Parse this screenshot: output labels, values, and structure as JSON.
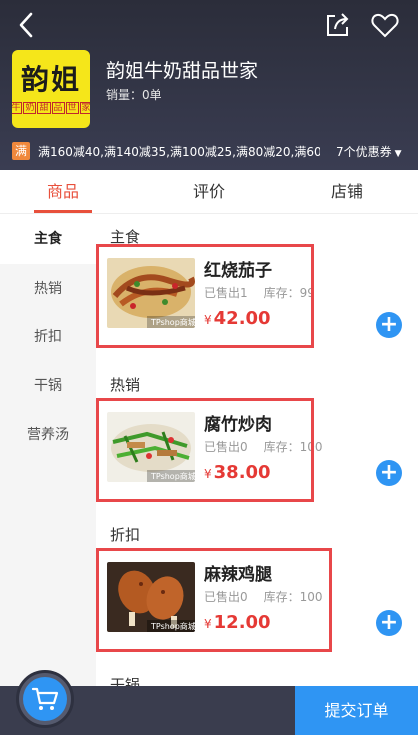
{
  "header": {
    "shop_name": "韵姐牛奶甜品世家",
    "sales": "销量：0单",
    "logo_big": "韵姐",
    "logo_small": [
      "牛",
      "奶",
      "甜",
      "品",
      "世",
      "家"
    ],
    "promo_badge": "满",
    "promo_text": "满160减40,满140减35,满100减25,满80减20,满60...",
    "coupon": "7个优惠券",
    "icons": [
      "back-icon",
      "share-icon",
      "heart-icon"
    ]
  },
  "tabs": [
    {
      "label": "商品",
      "active": true
    },
    {
      "label": "评价",
      "active": false
    },
    {
      "label": "店铺",
      "active": false
    }
  ],
  "categories": [
    {
      "label": "主食",
      "active": true
    },
    {
      "label": "热销",
      "active": false
    },
    {
      "label": "折扣",
      "active": false
    },
    {
      "label": "干锅",
      "active": false
    },
    {
      "label": "营养汤",
      "active": false
    }
  ],
  "sections": [
    {
      "title": "主食",
      "item": {
        "name": "红烧茄子",
        "sold": "已售出1",
        "stock": "库存：99",
        "currency": "¥",
        "price": "42.00",
        "watermark": "TPshop商城"
      }
    },
    {
      "title": "热销",
      "item": {
        "name": "腐竹炒肉",
        "sold": "已售出0",
        "stock": "库存：100",
        "currency": "¥",
        "price": "38.00",
        "watermark": "TPshop商城"
      }
    },
    {
      "title": "折扣",
      "item": {
        "name": "麻辣鸡腿",
        "sold": "已售出0",
        "stock": "库存：100",
        "currency": "¥",
        "price": "12.00",
        "watermark": "TPshop商城"
      }
    },
    {
      "title": "干锅"
    }
  ],
  "footer": {
    "submit": "提交订单"
  },
  "colors": {
    "accent": "#e8503c",
    "price": "#e53935",
    "blue": "#2f95f3",
    "header_bg": "#2b2d3a"
  }
}
